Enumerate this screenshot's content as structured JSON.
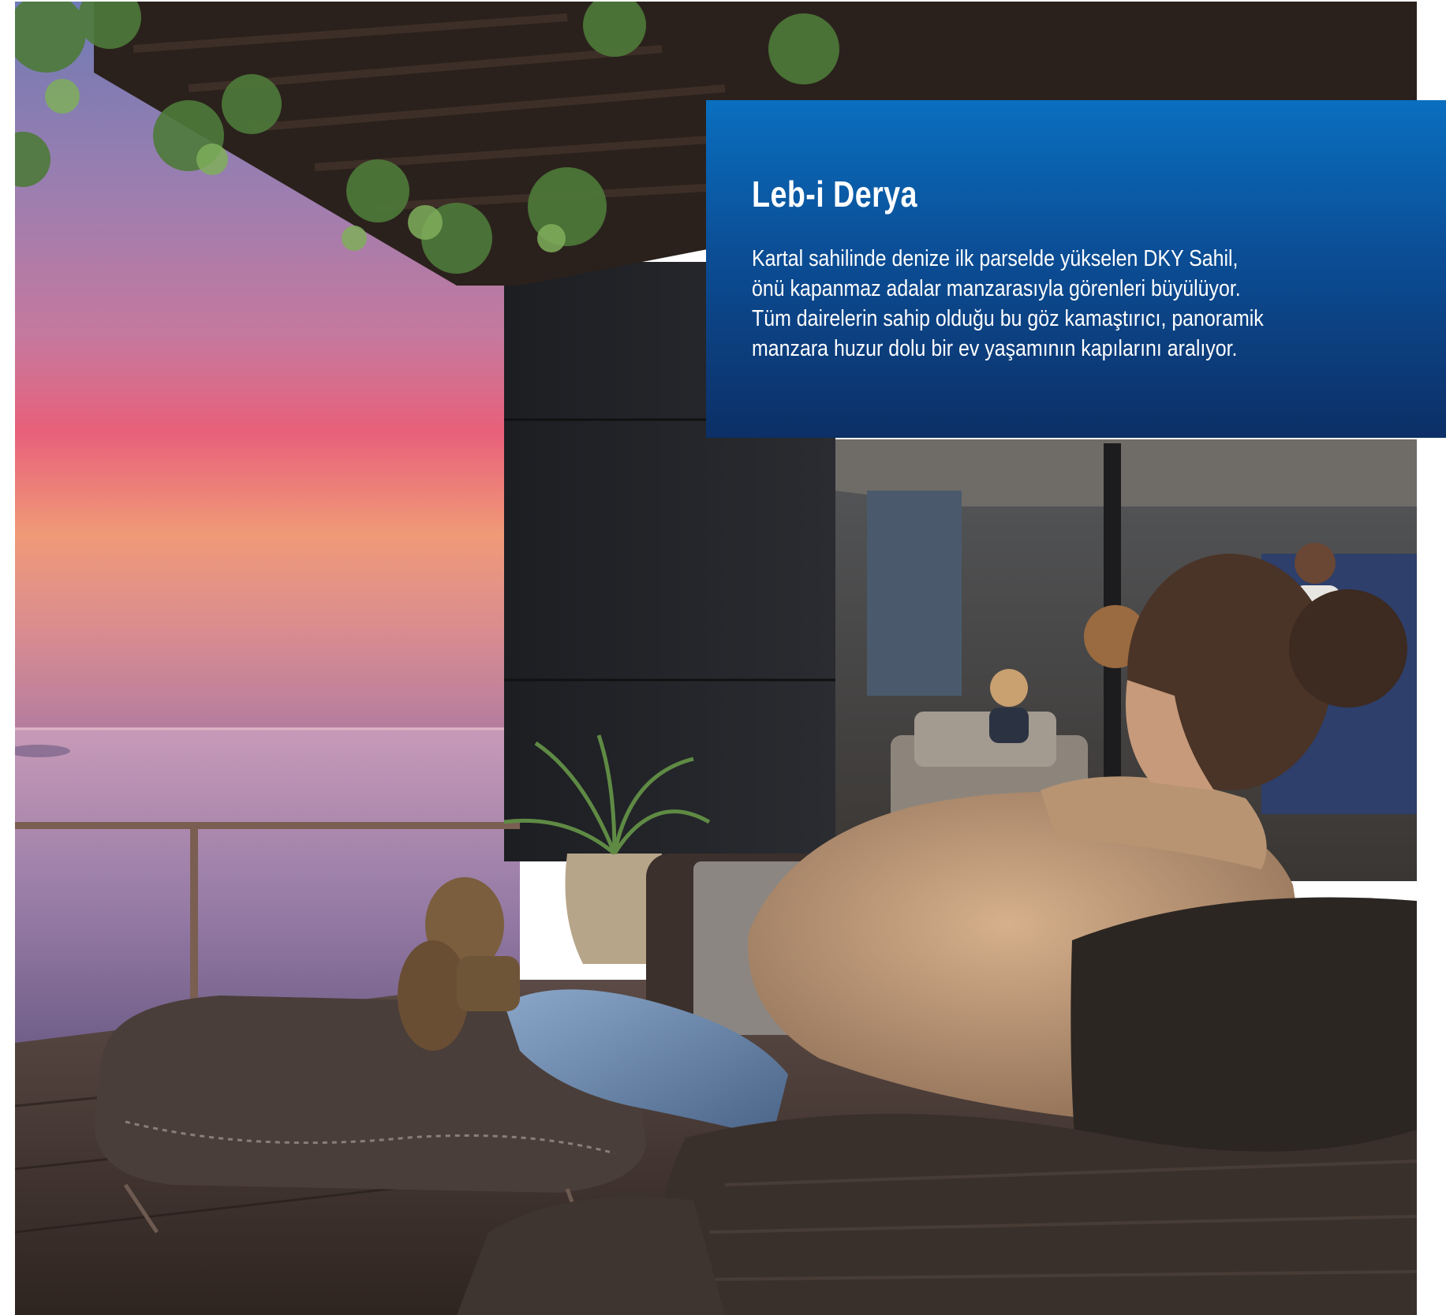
{
  "panel": {
    "title": "Leb-i Derya",
    "lines": [
      "Kartal sahilinde denize ilk parselde yükselen DKY Sahil,",
      "önü kapanmaz adalar manzarasıyla görenleri büyülüyor.",
      "Tüm dairelerin sahip olduğu bu göz kamaştırıcı, panoramik",
      "manzara huzur dolu bir ev yaşamının kapılarını aralıyor."
    ],
    "background_top": "#0a6fbf",
    "background_bottom": "#0c2f66",
    "text_color": "#ffffff"
  },
  "photo": {
    "subject": "woman-relaxing-on-terrace-sunset-sea-view",
    "sky_colors": [
      "#7a6aa8",
      "#c48aa8",
      "#e0607a",
      "#f0a070"
    ],
    "sea_color": "#9a7fa8"
  }
}
